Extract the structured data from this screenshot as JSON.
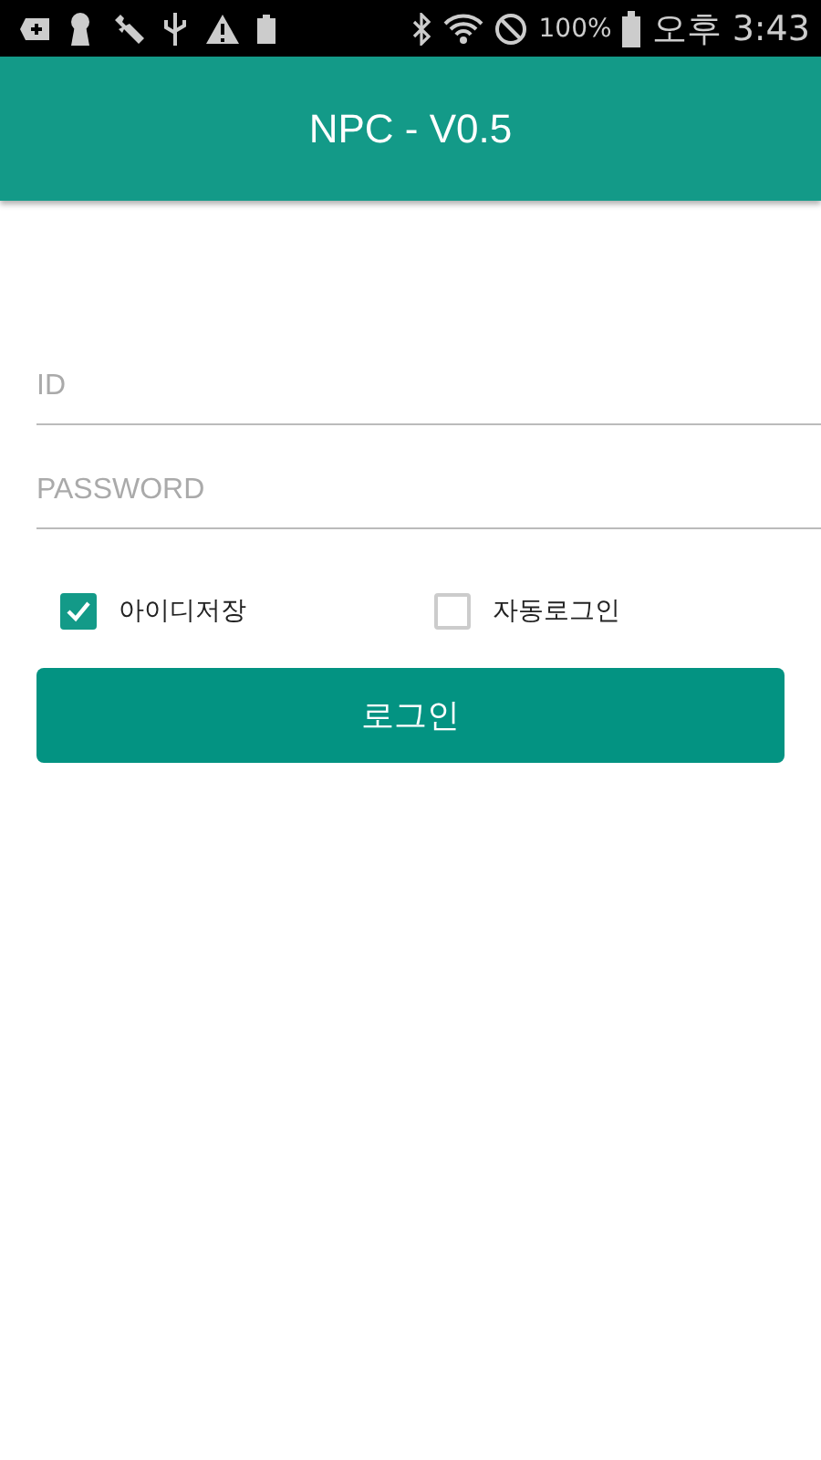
{
  "status_bar": {
    "battery_text": "100%",
    "time": "오후 3:43"
  },
  "app_bar": {
    "title": "NPC - V0.5"
  },
  "fields": [
    {
      "placeholder": "ID"
    },
    {
      "placeholder": "PASSWORD"
    }
  ],
  "checkboxes": [
    {
      "label": "아이디저장",
      "checked": true
    },
    {
      "label": "자동로그인",
      "checked": false
    }
  ],
  "login_button": "로그인"
}
